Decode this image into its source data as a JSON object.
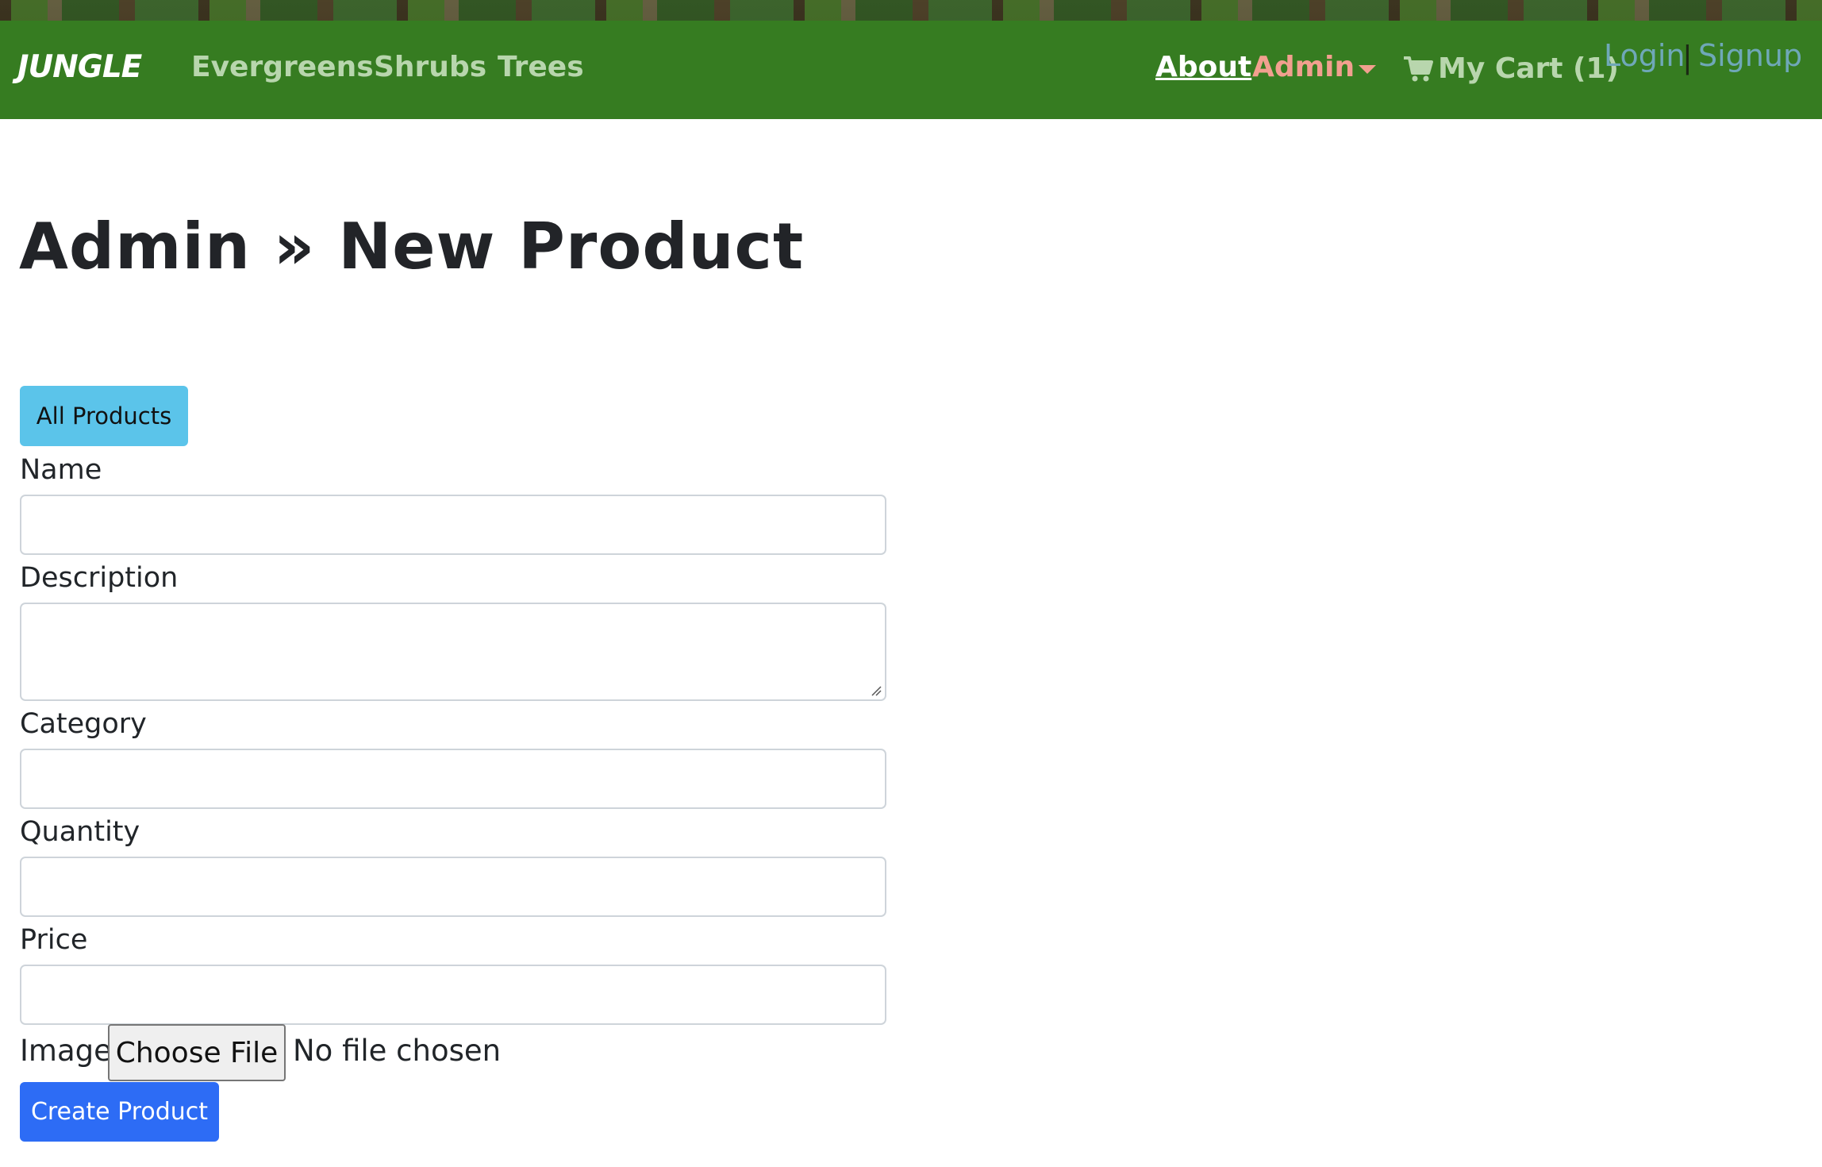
{
  "navbar": {
    "brand": "JUNGLE",
    "links": [
      "Evergreens",
      "Shrubs",
      "Trees"
    ],
    "about": "About",
    "admin": "Admin",
    "cart": "My Cart (1)",
    "login": "Login",
    "separator": "|",
    "signup": "Signup",
    "colors": {
      "background": "#367c21",
      "link": "#b8d6ad",
      "admin": "#f2a08f",
      "auth": "#6fa8b8"
    }
  },
  "page": {
    "title": "Admin » New Product",
    "all_products_label": "All Products"
  },
  "form": {
    "name_label": "Name",
    "description_label": "Description",
    "category_label": "Category",
    "quantity_label": "Quantity",
    "price_label": "Price",
    "image_label": "Image",
    "choose_file_label": "Choose File",
    "no_file_text": "No file chosen",
    "submit_label": "Create Product",
    "colors": {
      "all_products": "#5bc4ea",
      "submit": "#2d6cf5"
    }
  }
}
